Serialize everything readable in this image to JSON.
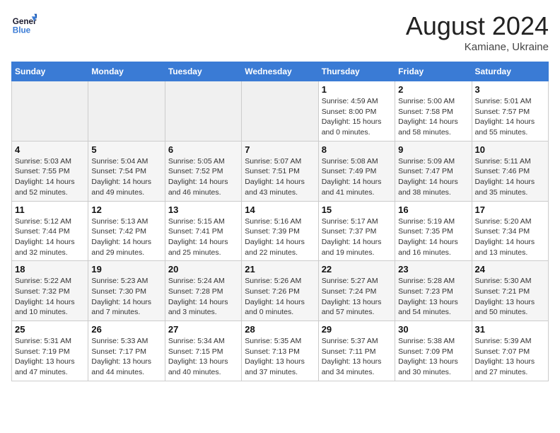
{
  "header": {
    "logo_general": "General",
    "logo_blue": "Blue",
    "month_year": "August 2024",
    "location": "Kamiane, Ukraine"
  },
  "weekdays": [
    "Sunday",
    "Monday",
    "Tuesday",
    "Wednesday",
    "Thursday",
    "Friday",
    "Saturday"
  ],
  "weeks": [
    [
      {
        "num": "",
        "empty": true
      },
      {
        "num": "",
        "empty": true
      },
      {
        "num": "",
        "empty": true
      },
      {
        "num": "",
        "empty": true
      },
      {
        "num": "1",
        "info": "Sunrise: 4:59 AM\nSunset: 8:00 PM\nDaylight: 15 hours\nand 0 minutes."
      },
      {
        "num": "2",
        "info": "Sunrise: 5:00 AM\nSunset: 7:58 PM\nDaylight: 14 hours\nand 58 minutes."
      },
      {
        "num": "3",
        "info": "Sunrise: 5:01 AM\nSunset: 7:57 PM\nDaylight: 14 hours\nand 55 minutes."
      }
    ],
    [
      {
        "num": "4",
        "info": "Sunrise: 5:03 AM\nSunset: 7:55 PM\nDaylight: 14 hours\nand 52 minutes."
      },
      {
        "num": "5",
        "info": "Sunrise: 5:04 AM\nSunset: 7:54 PM\nDaylight: 14 hours\nand 49 minutes."
      },
      {
        "num": "6",
        "info": "Sunrise: 5:05 AM\nSunset: 7:52 PM\nDaylight: 14 hours\nand 46 minutes."
      },
      {
        "num": "7",
        "info": "Sunrise: 5:07 AM\nSunset: 7:51 PM\nDaylight: 14 hours\nand 43 minutes."
      },
      {
        "num": "8",
        "info": "Sunrise: 5:08 AM\nSunset: 7:49 PM\nDaylight: 14 hours\nand 41 minutes."
      },
      {
        "num": "9",
        "info": "Sunrise: 5:09 AM\nSunset: 7:47 PM\nDaylight: 14 hours\nand 38 minutes."
      },
      {
        "num": "10",
        "info": "Sunrise: 5:11 AM\nSunset: 7:46 PM\nDaylight: 14 hours\nand 35 minutes."
      }
    ],
    [
      {
        "num": "11",
        "info": "Sunrise: 5:12 AM\nSunset: 7:44 PM\nDaylight: 14 hours\nand 32 minutes."
      },
      {
        "num": "12",
        "info": "Sunrise: 5:13 AM\nSunset: 7:42 PM\nDaylight: 14 hours\nand 29 minutes."
      },
      {
        "num": "13",
        "info": "Sunrise: 5:15 AM\nSunset: 7:41 PM\nDaylight: 14 hours\nand 25 minutes."
      },
      {
        "num": "14",
        "info": "Sunrise: 5:16 AM\nSunset: 7:39 PM\nDaylight: 14 hours\nand 22 minutes."
      },
      {
        "num": "15",
        "info": "Sunrise: 5:17 AM\nSunset: 7:37 PM\nDaylight: 14 hours\nand 19 minutes."
      },
      {
        "num": "16",
        "info": "Sunrise: 5:19 AM\nSunset: 7:35 PM\nDaylight: 14 hours\nand 16 minutes."
      },
      {
        "num": "17",
        "info": "Sunrise: 5:20 AM\nSunset: 7:34 PM\nDaylight: 14 hours\nand 13 minutes."
      }
    ],
    [
      {
        "num": "18",
        "info": "Sunrise: 5:22 AM\nSunset: 7:32 PM\nDaylight: 14 hours\nand 10 minutes."
      },
      {
        "num": "19",
        "info": "Sunrise: 5:23 AM\nSunset: 7:30 PM\nDaylight: 14 hours\nand 7 minutes."
      },
      {
        "num": "20",
        "info": "Sunrise: 5:24 AM\nSunset: 7:28 PM\nDaylight: 14 hours\nand 3 minutes."
      },
      {
        "num": "21",
        "info": "Sunrise: 5:26 AM\nSunset: 7:26 PM\nDaylight: 14 hours\nand 0 minutes."
      },
      {
        "num": "22",
        "info": "Sunrise: 5:27 AM\nSunset: 7:24 PM\nDaylight: 13 hours\nand 57 minutes."
      },
      {
        "num": "23",
        "info": "Sunrise: 5:28 AM\nSunset: 7:23 PM\nDaylight: 13 hours\nand 54 minutes."
      },
      {
        "num": "24",
        "info": "Sunrise: 5:30 AM\nSunset: 7:21 PM\nDaylight: 13 hours\nand 50 minutes."
      }
    ],
    [
      {
        "num": "25",
        "info": "Sunrise: 5:31 AM\nSunset: 7:19 PM\nDaylight: 13 hours\nand 47 minutes."
      },
      {
        "num": "26",
        "info": "Sunrise: 5:33 AM\nSunset: 7:17 PM\nDaylight: 13 hours\nand 44 minutes."
      },
      {
        "num": "27",
        "info": "Sunrise: 5:34 AM\nSunset: 7:15 PM\nDaylight: 13 hours\nand 40 minutes."
      },
      {
        "num": "28",
        "info": "Sunrise: 5:35 AM\nSunset: 7:13 PM\nDaylight: 13 hours\nand 37 minutes."
      },
      {
        "num": "29",
        "info": "Sunrise: 5:37 AM\nSunset: 7:11 PM\nDaylight: 13 hours\nand 34 minutes."
      },
      {
        "num": "30",
        "info": "Sunrise: 5:38 AM\nSunset: 7:09 PM\nDaylight: 13 hours\nand 30 minutes."
      },
      {
        "num": "31",
        "info": "Sunrise: 5:39 AM\nSunset: 7:07 PM\nDaylight: 13 hours\nand 27 minutes."
      }
    ]
  ]
}
